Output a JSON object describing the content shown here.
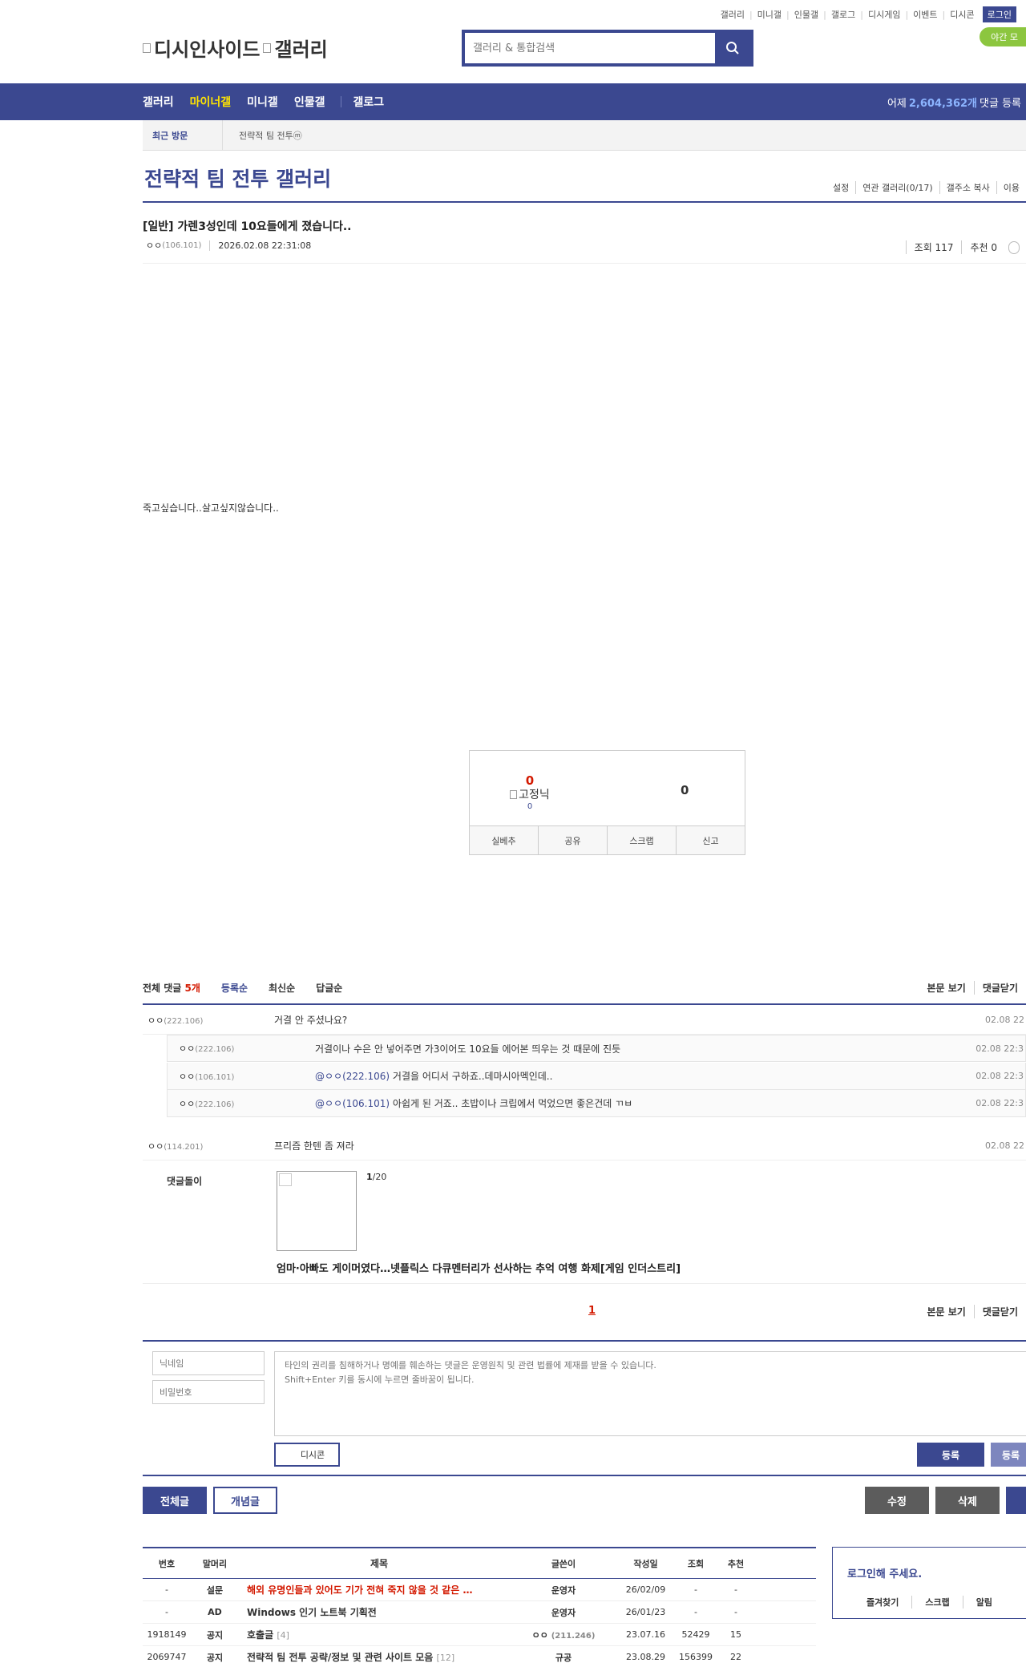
{
  "top_util": [
    "갤러리",
    "미니갤",
    "인물갤",
    "갤로그",
    "디시게임",
    "이벤트",
    "디시콘"
  ],
  "login_label": "로그인",
  "night_label": "야간 모",
  "logo": {
    "part1": "디시인사이드",
    "part2": "갤러리"
  },
  "search": {
    "placeholder": "갤러리 & 통합검색"
  },
  "gnb": {
    "items": [
      "갤러리",
      "마이너갤",
      "미니갤",
      "인물갤"
    ],
    "gallog": "갤로그",
    "stat_prefix": "어제",
    "stat_count": "2,604,362개",
    "stat_suffix": "댓글 등록"
  },
  "recent": {
    "label": "최근 방문",
    "item": "전략적 팀 전투ⓜ"
  },
  "gallery": {
    "title": "전략적 팀 전투 갤러리",
    "options": [
      "설정",
      "연관 갤러리(0/17)",
      "갤주소 복사",
      "이용"
    ]
  },
  "post": {
    "title": "[일반] 가렌3성인데 10요들에게 졌습니다..",
    "writer": "ㅇㅇ",
    "writer_ip": "(106.101)",
    "date": "2026.02.08 22:31:08",
    "views": "조회 117",
    "reco": "추천 0",
    "body": "죽고싶습니다..살고싶지않습니다.."
  },
  "recommend": {
    "up_count": "0",
    "fix_label": "고정닉",
    "fix_count": "0",
    "down_count": "0",
    "buttons": [
      "실베추",
      "공유",
      "스크랩",
      "신고"
    ]
  },
  "comments": {
    "total_label": "전체 댓글",
    "total_count": "5개",
    "sorts": [
      "등록순",
      "최신순",
      "답글순"
    ],
    "view_body": "본문 보기",
    "close": "댓글닫기",
    "items": [
      {
        "nick": "ㅇㅇ",
        "ip": "(222.106)",
        "text": "거결 안 주셨나요?",
        "date": "02.08 22"
      },
      {
        "nick": "ㅇㅇ",
        "ip": "(114.201)",
        "text": "프리즘 한텐 좀 져라",
        "date": "02.08 22"
      }
    ],
    "replies": [
      {
        "nick": "ㅇㅇ",
        "ip": "(222.106)",
        "mention": "",
        "text": "거결이나 수은 안 넣어주면 가3이어도 10요들 에어본 띄우는 것 때문에 진듯",
        "date": "02.08 22:3"
      },
      {
        "nick": "ㅇㅇ",
        "ip": "(106.101)",
        "mention": "@ㅇㅇ(222.106)",
        "text": "거결을 어디서 구하죠..데마시아멕인데..",
        "date": "02.08 22:3"
      },
      {
        "nick": "ㅇㅇ",
        "ip": "(222.106)",
        "mention": "@ㅇㅇ(106.101)",
        "text": "아쉽게 된 거죠.. 초밥이나 크립에서 먹었으면 좋은건데 ㄲㅂ",
        "date": "02.08 22:3"
      }
    ],
    "dolgi": {
      "label": "댓글돌이",
      "page_current": "1",
      "page_total": "/20",
      "title": "엄마·아빠도 게이머였다…넷플릭스 다큐멘터리가 선사하는 추억 여행 화제[게임 인더스트리]"
    },
    "page": "1"
  },
  "write": {
    "nick_placeholder": "닉네임",
    "pw_placeholder": "비밀번호",
    "text_placeholder": "타인의 권리를 침해하거나 명예를 훼손하는 댓글은 운영원칙 및 관련 법률에 제재를 받을 수 있습니다.\nShift+Enter 키를 동시에 누르면 줄바꿈이 됩니다.",
    "dccon": "디시콘",
    "submit": "등록",
    "submit2": "등록"
  },
  "bottom": {
    "all": "전체글",
    "concept": "개념글",
    "edit": "수정",
    "delete": "삭제"
  },
  "list": {
    "headers": [
      "번호",
      "말머리",
      "제목",
      "글쓴이",
      "작성일",
      "조회",
      "추천"
    ],
    "rows": [
      {
        "num": "-",
        "head": "설문",
        "title": "해외 유명인들과 있어도 기가 전혀 죽지 않을 것 같은 …",
        "replies": "",
        "writer": "운영자",
        "ip": "",
        "date": "26/02/09",
        "views": "-",
        "reco": "-"
      },
      {
        "num": "-",
        "head": "AD",
        "title": "Windows 인기 노트북 기획전",
        "replies": "",
        "writer": "운영자",
        "ip": "",
        "date": "26/01/23",
        "views": "-",
        "reco": "-"
      },
      {
        "num": "1918149",
        "head": "공지",
        "title": "호출글",
        "replies": "[4]",
        "writer": "ㅇㅇ",
        "ip": "(211.246)",
        "date": "23.07.16",
        "views": "52429",
        "reco": "15"
      },
      {
        "num": "2069747",
        "head": "공지",
        "title": "전략적 팀 전투 공략/정보 및 관련 사이트 모음",
        "replies": "[12]",
        "writer": "규공",
        "ip": "",
        "date": "23.08.29",
        "views": "156399",
        "reco": "22"
      }
    ]
  },
  "login_box": {
    "message": "로그인해 주세요.",
    "links": [
      "즐겨찾기",
      "스크랩",
      "알림"
    ]
  },
  "colors": {
    "primary": "#3b4890",
    "accent": "#ffe400",
    "red": "#d31900",
    "night": "#8cc63f"
  }
}
